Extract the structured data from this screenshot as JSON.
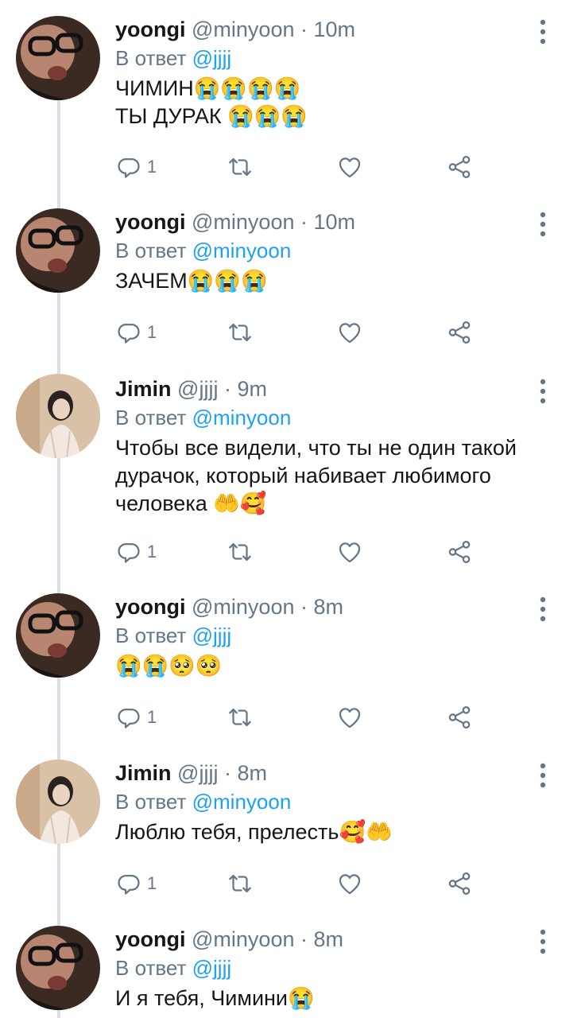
{
  "tweets": [
    {
      "name": "yoongi",
      "handle": "@minyoon",
      "sep": "·",
      "time": "10m",
      "reply_prefix": "В ответ",
      "reply_to": "@jjjj",
      "lines": [
        "ЧИМИН😭😭😭😭",
        "ТЫ ДУРАК 😭😭😭"
      ],
      "reply_count": "1",
      "avatar": "yoongi"
    },
    {
      "name": "yoongi",
      "handle": "@minyoon",
      "sep": "·",
      "time": "10m",
      "reply_prefix": "В ответ",
      "reply_to": "@minyoon",
      "lines": [
        "ЗАЧЕМ😭😭😭"
      ],
      "reply_count": "1",
      "avatar": "yoongi"
    },
    {
      "name": "Jimin",
      "handle": "@jjjj",
      "sep": "·",
      "time": "9m",
      "reply_prefix": "В ответ",
      "reply_to": "@minyoon",
      "lines": [
        "Чтобы все видели, что ты не один такой",
        "дурачок, который набивает любимого",
        "человека 🤲🥰"
      ],
      "reply_count": "1",
      "avatar": "jimin"
    },
    {
      "name": "yoongi",
      "handle": "@minyoon",
      "sep": "·",
      "time": "8m",
      "reply_prefix": "В ответ",
      "reply_to": "@jjjj",
      "lines": [
        "😭😭🥺🥺"
      ],
      "reply_count": "1",
      "avatar": "yoongi"
    },
    {
      "name": "Jimin",
      "handle": "@jjjj",
      "sep": "·",
      "time": "8m",
      "reply_prefix": "В ответ",
      "reply_to": "@minyoon",
      "lines": [
        "Люблю тебя, прелесть🥰🤲"
      ],
      "reply_count": "1",
      "avatar": "jimin"
    },
    {
      "name": "yoongi",
      "handle": "@minyoon",
      "sep": "·",
      "time": "8m",
      "reply_prefix": "В ответ",
      "reply_to": "@jjjj",
      "lines": [
        "И я тебя, Чимини😭"
      ],
      "reply_count": "",
      "avatar": "yoongi"
    }
  ],
  "icons": {
    "reply": "reply-icon",
    "retweet": "retweet-icon",
    "like": "heart-icon",
    "share": "share-icon",
    "more": "more-vertical-icon"
  },
  "colors": {
    "mention": "#1da1f2",
    "muted": "#657786",
    "text": "#14171a",
    "thread_line": "#d9dfe4"
  }
}
